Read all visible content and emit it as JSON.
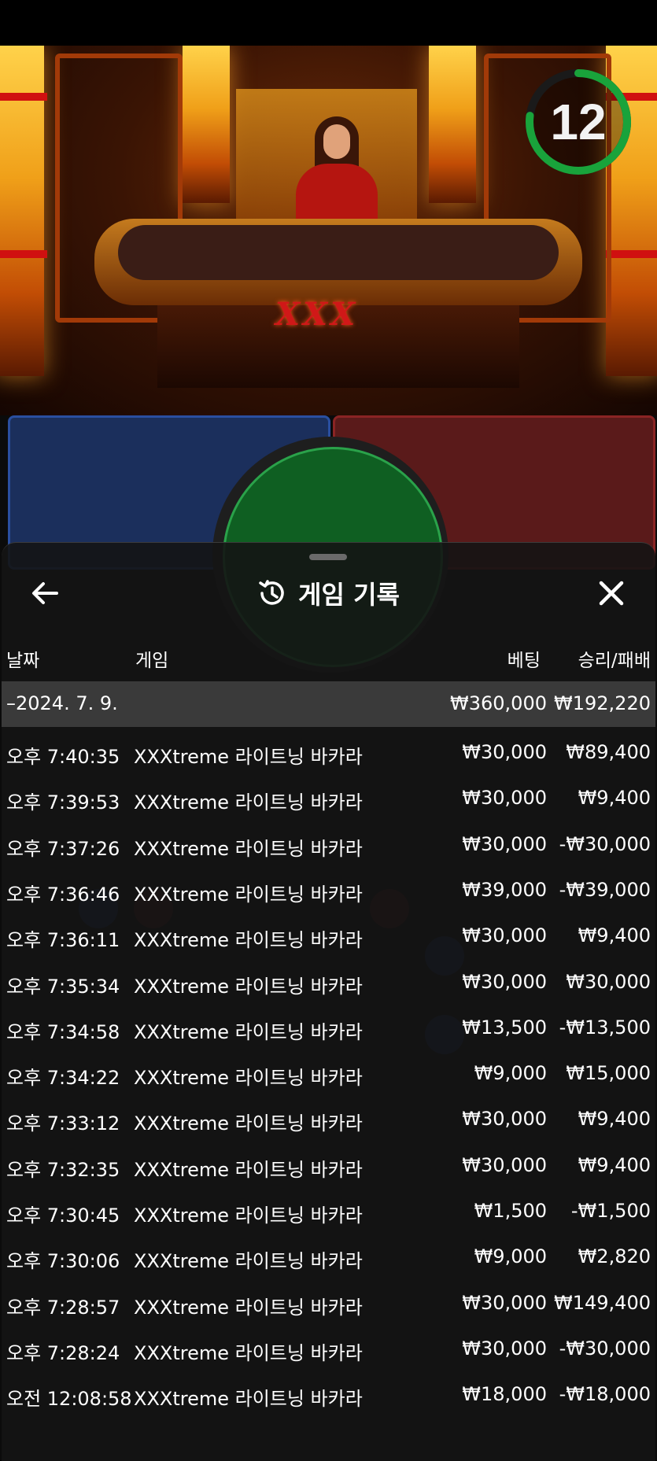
{
  "timer": {
    "seconds": "12",
    "color": "#19a33b"
  },
  "table_logo": "XXX",
  "header": {
    "title": "게임 기록",
    "back_icon": "arrow-left-icon",
    "history_icon": "history-clock-icon",
    "close_icon": "close-icon"
  },
  "columns": {
    "date": "날짜",
    "game": "게임",
    "bet": "베팅",
    "result": "승리/패배"
  },
  "date_group": {
    "label": "–2024. 7. 9.",
    "bet_total": "₩360,000",
    "result_total": "₩192,220"
  },
  "rows": [
    {
      "time": "오후 7:40:35",
      "game": "XXXtreme 라이트닝 바카라",
      "bet": "₩30,000",
      "result": "₩89,400"
    },
    {
      "time": "오후 7:39:53",
      "game": "XXXtreme 라이트닝 바카라",
      "bet": "₩30,000",
      "result": "₩9,400"
    },
    {
      "time": "오후 7:37:26",
      "game": "XXXtreme 라이트닝 바카라",
      "bet": "₩30,000",
      "result": "-₩30,000"
    },
    {
      "time": "오후 7:36:46",
      "game": "XXXtreme 라이트닝 바카라",
      "bet": "₩39,000",
      "result": "-₩39,000"
    },
    {
      "time": "오후 7:36:11",
      "game": "XXXtreme 라이트닝 바카라",
      "bet": "₩30,000",
      "result": "₩9,400"
    },
    {
      "time": "오후 7:35:34",
      "game": "XXXtreme 라이트닝 바카라",
      "bet": "₩30,000",
      "result": "₩30,000"
    },
    {
      "time": "오후 7:34:58",
      "game": "XXXtreme 라이트닝 바카라",
      "bet": "₩13,500",
      "result": "-₩13,500"
    },
    {
      "time": "오후 7:34:22",
      "game": "XXXtreme 라이트닝 바카라",
      "bet": "₩9,000",
      "result": "₩15,000"
    },
    {
      "time": "오후 7:33:12",
      "game": "XXXtreme 라이트닝 바카라",
      "bet": "₩30,000",
      "result": "₩9,400"
    },
    {
      "time": "오후 7:32:35",
      "game": "XXXtreme 라이트닝 바카라",
      "bet": "₩30,000",
      "result": "₩9,400"
    },
    {
      "time": "오후 7:30:45",
      "game": "XXXtreme 라이트닝 바카라",
      "bet": "₩1,500",
      "result": "-₩1,500"
    },
    {
      "time": "오후 7:30:06",
      "game": "XXXtreme 라이트닝 바카라",
      "bet": "₩9,000",
      "result": "₩2,820"
    },
    {
      "time": "오후 7:28:57",
      "game": "XXXtreme 라이트닝 바카라",
      "bet": "₩30,000",
      "result": "₩149,400"
    },
    {
      "time": "오후 7:28:24",
      "game": "XXXtreme 라이트닝 바카라",
      "bet": "₩30,000",
      "result": "-₩30,000"
    },
    {
      "time": "오전 12:08:58",
      "game": "XXXtreme 라이트닝 바카라",
      "bet": "₩18,000",
      "result": "-₩18,000"
    }
  ]
}
